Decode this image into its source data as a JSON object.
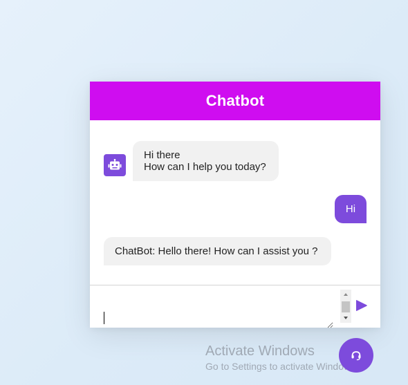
{
  "chat": {
    "title": "Chatbot",
    "messages": [
      {
        "sender": "bot",
        "lines": [
          "Hi there",
          "How can I help you today?"
        ]
      },
      {
        "sender": "user",
        "text": "Hi"
      },
      {
        "sender": "bot",
        "text": "ChatBot: Hello there! How can I assist you ?"
      }
    ],
    "input": {
      "value": "",
      "placeholder": ""
    }
  },
  "icons": {
    "bot_avatar": "robot-icon",
    "send": "send-icon",
    "fab": "headset-icon"
  },
  "colors": {
    "header": "#cf0df0",
    "accent": "#7d4bdc",
    "incoming_bubble": "#f1f1f1",
    "text": "#222222"
  },
  "watermark": {
    "title": "Activate Windows",
    "subtitle": "Go to Settings to activate Windows."
  }
}
